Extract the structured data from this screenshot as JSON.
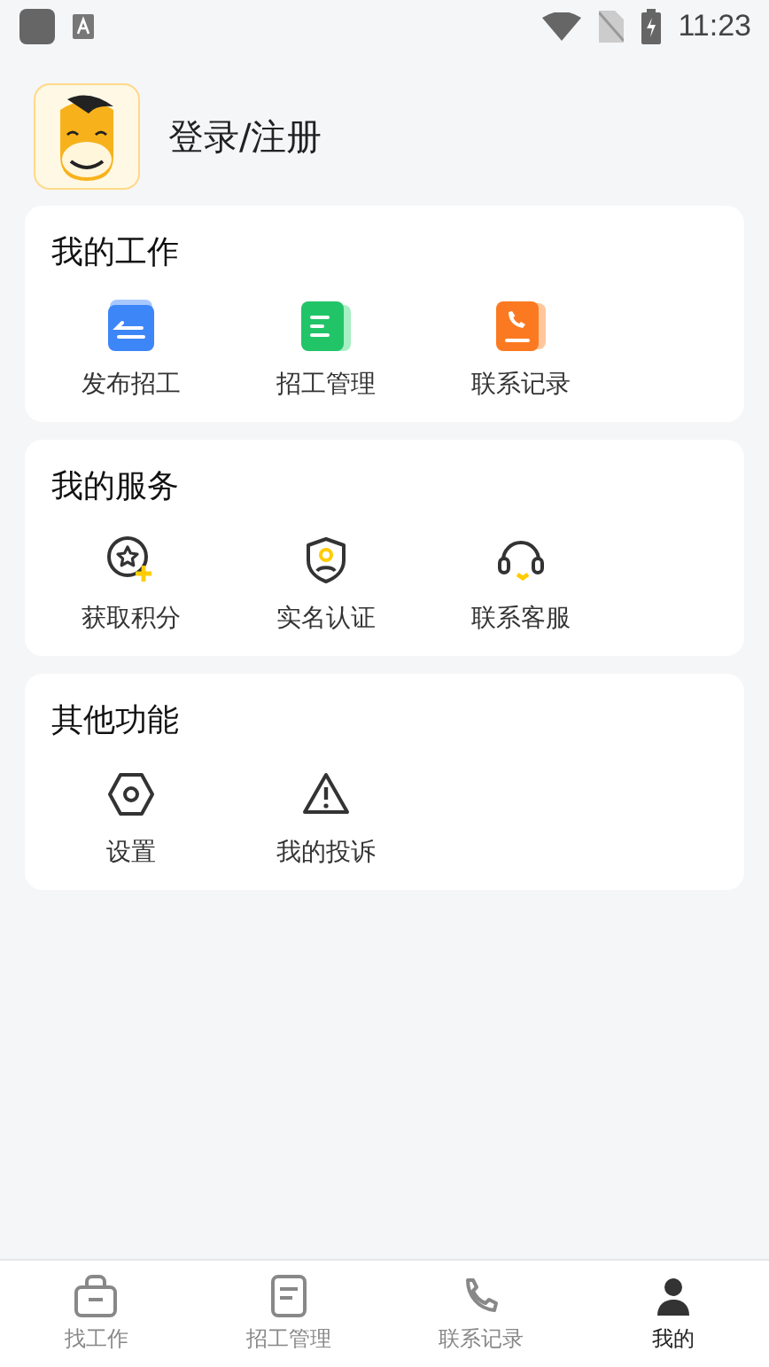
{
  "status_bar": {
    "time": "11:23"
  },
  "profile": {
    "login_label": "登录/注册"
  },
  "sections": [
    {
      "title": "我的工作",
      "items": [
        {
          "label": "发布招工"
        },
        {
          "label": "招工管理"
        },
        {
          "label": "联系记录"
        }
      ]
    },
    {
      "title": "我的服务",
      "items": [
        {
          "label": "获取积分"
        },
        {
          "label": "实名认证"
        },
        {
          "label": "联系客服"
        }
      ]
    },
    {
      "title": "其他功能",
      "items": [
        {
          "label": "设置"
        },
        {
          "label": "我的投诉"
        }
      ]
    }
  ],
  "tab_bar": [
    {
      "label": "找工作",
      "selected": false
    },
    {
      "label": "招工管理",
      "selected": false
    },
    {
      "label": "联系记录",
      "selected": false
    },
    {
      "label": "我的",
      "selected": true
    }
  ]
}
